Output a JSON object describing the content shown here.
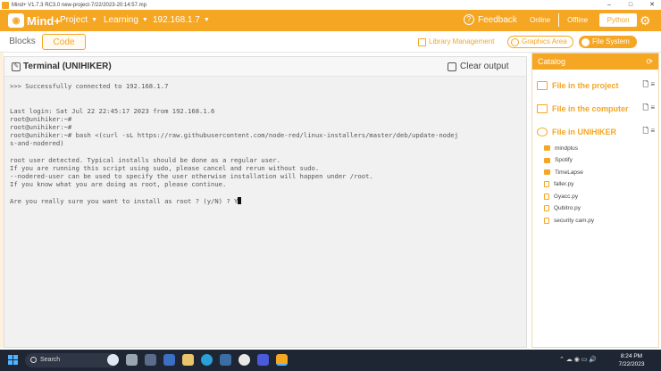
{
  "window": {
    "title": "Mind+ V1.7.3 RC3.0   new-project-7/22/2023-20:14:57.mp",
    "min": "–",
    "max": "□",
    "close": "✕"
  },
  "menubar": {
    "brand": "Mind+",
    "project": "Project",
    "learning": "Learning",
    "device": "192.168.1.7",
    "feedback": "Feedback",
    "modes": {
      "online": "Online",
      "offline": "Offline",
      "python": "Python"
    }
  },
  "tabs": {
    "blocks": "Blocks",
    "code": "Code"
  },
  "toolbar": {
    "library": "Library Management",
    "graphics": "Graphics Area",
    "filesystem": "File System"
  },
  "terminal": {
    "title": "Terminal (UNIHIKER)",
    "clear": "Clear output",
    "lines": [
      ">>> Successfully connected to 192.168.1.7",
      "",
      "",
      "Last login: Sat Jul 22 22:45:17 2023 from 192.168.1.6",
      "root@unihiker:~#",
      "root@unihiker:~#",
      "root@unihiker:~# bash <(curl -sL https://raw.githubusercontent.com/node-red/linux-installers/master/deb/update-nodej",
      "s-and-nodered)",
      "",
      "root user detected. Typical installs should be done as a regular user.",
      "If you are running this script using sudo, please cancel and rerun without sudo.",
      "--nodered-user can be used to specify the user otherwise installation will happen under /root.",
      "If you know what you are doing as root, please continue.",
      "",
      "Are you really sure you want to install as root ? (y/N) ? Y"
    ]
  },
  "catalog": {
    "title": "Catalog",
    "sections": {
      "project": "File in the project",
      "computer": "File in the computer",
      "unihiker": "File in UNIHIKER"
    },
    "items": [
      {
        "name": "mindplus",
        "type": "folder"
      },
      {
        "name": "Spotify",
        "type": "folder"
      },
      {
        "name": "TimeLapse",
        "type": "folder"
      },
      {
        "name": "faller.py",
        "type": "file"
      },
      {
        "name": "Gyacc.py",
        "type": "file"
      },
      {
        "name": "Qubitro.py",
        "type": "file"
      },
      {
        "name": "security cam.py",
        "type": "file"
      }
    ]
  },
  "taskbar": {
    "search": "Search",
    "time": "8:24 PM",
    "date": "7/22/2023"
  },
  "colors": {
    "accent": "#f5a623",
    "taskbar": "#1f2633"
  }
}
